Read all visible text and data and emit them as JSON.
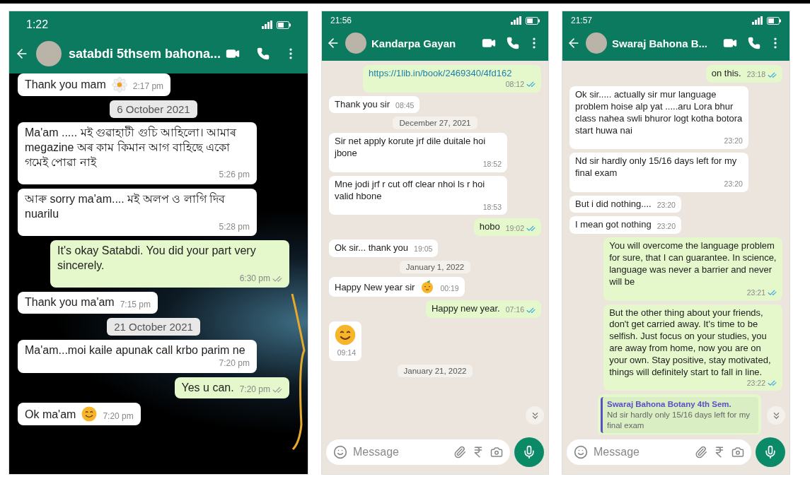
{
  "phones": [
    {
      "status_time": "1:22",
      "contact": "satabdi 5thsem bahona...",
      "scroll_down": false,
      "messages": [
        {
          "kind": "in",
          "text": "Thank you mam",
          "time": "2:17 pm",
          "emoji": {
            "kind": "flower"
          }
        },
        {
          "kind": "date",
          "text": "6 October 2021"
        },
        {
          "kind": "in",
          "text": "Ma'am ..... মই গুৱাহাটী গুচি আহিলো। আমাৰ megazine অৰ কাম কিমান আগ বাহিছে একো গমেই পোৱা নাই",
          "time": "5:26 pm"
        },
        {
          "kind": "in",
          "text": "আৰু sorry ma'am.... মই অলপ ও লাগি দিব nuarilu",
          "time": "5:28 pm"
        },
        {
          "kind": "out",
          "text": "It's okay Satabdi. You did your part very sincerely.",
          "time": "6:30 pm",
          "read": false
        },
        {
          "kind": "in",
          "text": "Thank you ma'am",
          "time": "7:15 pm"
        },
        {
          "kind": "date",
          "text": "21 October 2021"
        },
        {
          "kind": "in",
          "text": "Ma'am...moi kaile apunak call krbo parim ne",
          "time": "7:20 pm"
        },
        {
          "kind": "out",
          "text": "Yes u can.",
          "time": "7:20 pm",
          "read": false
        },
        {
          "kind": "in",
          "text": "Ok ma'am",
          "time": "7:20 pm",
          "emoji": {
            "kind": "smile"
          }
        }
      ]
    },
    {
      "status_time": "21:56",
      "contact": "Kandarpa Gayan",
      "scroll_down": true,
      "composer": {
        "placeholder": "Message"
      },
      "messages": [
        {
          "kind": "link",
          "text": "https://1lib.in/book/2469340/4fd162",
          "time": "08:12",
          "read": true
        },
        {
          "kind": "in",
          "text": "Thank you sir",
          "time": "08:45"
        },
        {
          "kind": "date",
          "text": "December 27, 2021"
        },
        {
          "kind": "in",
          "text": "Sir net apply korute jrf dile duitale hoi jbone",
          "time": "18:52"
        },
        {
          "kind": "in",
          "text": "Mne jodi jrf r cut off clear nhoi ls r hoi valid hbone",
          "time": "18:53"
        },
        {
          "kind": "out",
          "text": "hobo",
          "time": "19:02",
          "read": true
        },
        {
          "kind": "in",
          "text": "Ok sir... thank you",
          "time": "19:05"
        },
        {
          "kind": "date",
          "text": "January 1, 2022"
        },
        {
          "kind": "in",
          "text": "Happy New year sir",
          "time": "00:19",
          "emoji": {
            "kind": "party"
          }
        },
        {
          "kind": "out",
          "text": "Happy new year.",
          "time": "07:16",
          "read": true
        },
        {
          "kind": "emoji",
          "time": "09:14",
          "emoji": {
            "kind": "smile"
          }
        },
        {
          "kind": "date",
          "text": "January 21, 2022"
        }
      ]
    },
    {
      "status_time": "21:57",
      "contact": "Swaraj Bahona B...",
      "scroll_down": true,
      "composer": {
        "placeholder": "Message"
      },
      "messages": [
        {
          "kind": "out",
          "text": "on this.",
          "time": "23:18",
          "read": true
        },
        {
          "kind": "in",
          "text": "Ok sir..... actually sir mur language problem hoise alp yat .....aru Lora bhur class nahea swli bhuror logt kotha botora start huwa nai",
          "time": "23:20"
        },
        {
          "kind": "in",
          "text": "Nd sir hardly only 15/16 days left for my final exam",
          "time": "23:20"
        },
        {
          "kind": "in",
          "text": "But i did nothing....",
          "time": "23:20"
        },
        {
          "kind": "in",
          "text": "I mean got nothing",
          "time": "23:20"
        },
        {
          "kind": "out",
          "text": "You will overcome the language problem for sure, that I can guarantee. In science, language was never a barrier and never will be",
          "time": "23:21",
          "read": true
        },
        {
          "kind": "out",
          "text": "But the other thing about your friends, don't get carried away. It's time to be selfish. Just focus on your studies, you are away from home, now you are on your own. Stay positive, stay motivated, things will definitely start to fall in line.",
          "time": "23:22",
          "read": true
        },
        {
          "kind": "quote",
          "author": "Swaraj Bahona Botany 4th Sem.",
          "text": "Nd sir hardly only 15/16 days left for my final exam"
        }
      ]
    }
  ]
}
